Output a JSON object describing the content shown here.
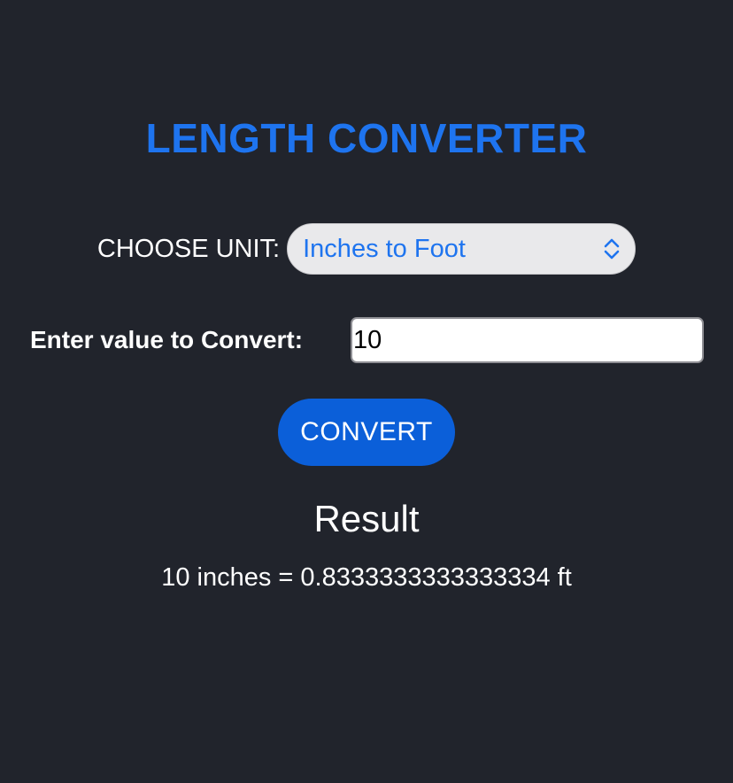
{
  "app": {
    "title": "LENGTH CONVERTER"
  },
  "unit_selector": {
    "label": "CHOOSE UNIT:",
    "selected": "Inches to Foot",
    "icon": "chevron-up-down-icon"
  },
  "value_input": {
    "label": "Enter value to Convert:",
    "value": "10"
  },
  "convert_button": {
    "label": "CONVERT"
  },
  "result": {
    "heading": "Result",
    "text": "10 inches = 0.8333333333333334 ft"
  },
  "colors": {
    "background": "#21242c",
    "accent": "#1e74ef",
    "button": "#0b5fd9",
    "select_background": "#e9e9eb"
  }
}
